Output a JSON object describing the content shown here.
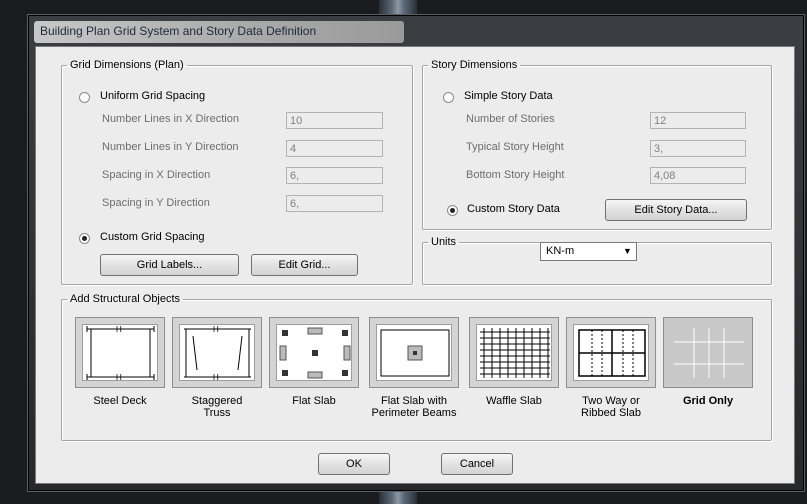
{
  "window": {
    "title": "Building Plan Grid System and Story Data Definition"
  },
  "grid_dimensions": {
    "legend": "Grid Dimensions (Plan)",
    "uniform_label": "Uniform Grid Spacing",
    "rows": [
      {
        "label": "Number Lines in X Direction",
        "value": "10"
      },
      {
        "label": "Number Lines in Y Direction",
        "value": "4"
      },
      {
        "label": "Spacing in X Direction",
        "value": "6,"
      },
      {
        "label": "Spacing in Y Direction",
        "value": "6,"
      }
    ],
    "custom_label": "Custom Grid Spacing",
    "grid_labels_button": "Grid Labels...",
    "edit_grid_button": "Edit Grid..."
  },
  "story_dimensions": {
    "legend": "Story Dimensions",
    "simple_label": "Simple Story Data",
    "rows": [
      {
        "label": "Number of Stories",
        "value": "12"
      },
      {
        "label": "Typical Story Height",
        "value": "3,"
      },
      {
        "label": "Bottom Story Height",
        "value": "4,08"
      }
    ],
    "custom_label": "Custom Story Data",
    "edit_story_button": "Edit Story Data..."
  },
  "units": {
    "legend": "Units",
    "selected": "KN-m"
  },
  "structural_objects": {
    "legend": "Add Structural Objects",
    "items": [
      {
        "line1": "Steel Deck",
        "line2": ""
      },
      {
        "line1": "Staggered",
        "line2": "Truss"
      },
      {
        "line1": "Flat Slab",
        "line2": ""
      },
      {
        "line1": "Flat Slab with",
        "line2": "Perimeter Beams"
      },
      {
        "line1": "Waffle Slab",
        "line2": ""
      },
      {
        "line1": "Two Way or",
        "line2": "Ribbed Slab"
      },
      {
        "line1": "Grid Only",
        "line2": ""
      }
    ]
  },
  "footer": {
    "ok": "OK",
    "cancel": "Cancel"
  }
}
